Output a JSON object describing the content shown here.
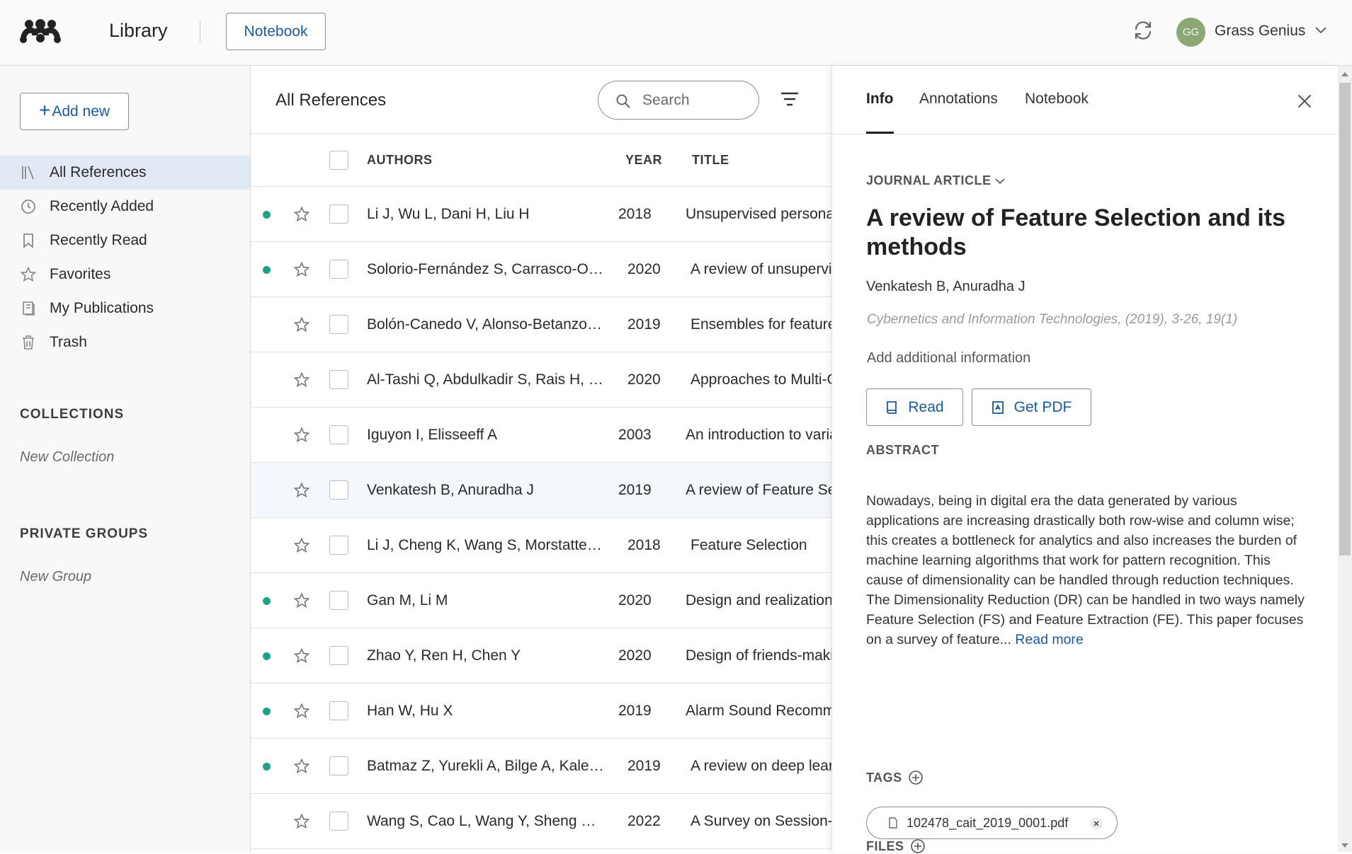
{
  "app": {
    "title": "Library",
    "notebook_button": "Notebook",
    "user_initials": "GG",
    "user_name": "Grass Genius",
    "accent": "#1a5a9e",
    "unread_dot_color": "#1ea084"
  },
  "sidebar": {
    "add_new": "Add new",
    "items": [
      {
        "label": "All References",
        "icon": "library-icon",
        "active": true
      },
      {
        "label": "Recently Added",
        "icon": "clock-icon"
      },
      {
        "label": "Recently Read",
        "icon": "bookmark-icon"
      },
      {
        "label": "Favorites",
        "icon": "star-icon"
      },
      {
        "label": "My Publications",
        "icon": "publications-icon"
      },
      {
        "label": "Trash",
        "icon": "trash-icon"
      }
    ],
    "collections_heading": "COLLECTIONS",
    "new_collection": "New Collection",
    "groups_heading": "PRIVATE GROUPS",
    "new_group": "New Group"
  },
  "list": {
    "title": "All References",
    "search_placeholder": "Search",
    "columns": {
      "authors": "AUTHORS",
      "year": "YEAR",
      "title": "TITLE"
    },
    "rows": [
      {
        "unread": true,
        "authors": "Li J, Wu L, Dani H, Liu H",
        "year": "2018",
        "title": "Unsupervised personalized"
      },
      {
        "unread": true,
        "authors": "Solorio-Fernández S, Carrasco-O…",
        "year": "2020",
        "title": "A review of unsupervised"
      },
      {
        "unread": false,
        "authors": "Bolón-Canedo V, Alonso-Betanzo…",
        "year": "2019",
        "title": "Ensembles for feature"
      },
      {
        "unread": false,
        "authors": "Al-Tashi Q, Abdulkadir S, Rais H, …",
        "year": "2020",
        "title": "Approaches to Multi-Objective"
      },
      {
        "unread": false,
        "authors": "Iguyon I, Elisseeff A",
        "year": "2003",
        "title": "An introduction to variable"
      },
      {
        "unread": false,
        "authors": "Venkatesh B, Anuradha J",
        "year": "2019",
        "title": "A review of Feature Selection",
        "selected": true
      },
      {
        "unread": false,
        "authors": "Li J, Cheng K, Wang S, Morstatte…",
        "year": "2018",
        "title": "Feature Selection"
      },
      {
        "unread": true,
        "authors": "Gan M, Li M",
        "year": "2020",
        "title": "Design and realization"
      },
      {
        "unread": true,
        "authors": "Zhao Y, Ren H, Chen Y",
        "year": "2020",
        "title": "Design of friends-making"
      },
      {
        "unread": true,
        "authors": "Han W, Hu X",
        "year": "2019",
        "title": "Alarm Sound Recommendation"
      },
      {
        "unread": true,
        "authors": "Batmaz Z, Yurekli A, Bilge A, Kale…",
        "year": "2019",
        "title": "A review on deep learning"
      },
      {
        "unread": false,
        "authors": "Wang S, Cao L, Wang Y, Sheng …",
        "year": "2022",
        "title": "A Survey on Session-based"
      }
    ]
  },
  "detail": {
    "tabs": [
      "Info",
      "Annotations",
      "Notebook"
    ],
    "type": "JOURNAL ARTICLE",
    "title": "A review of Feature Selection and its methods",
    "authors": "Venkatesh B, Anuradha J",
    "source": "Cybernetics and Information Technologies, (2019), 3-26, 19(1)",
    "add_info": "Add additional information",
    "read_button": "Read",
    "pdf_button": "Get PDF",
    "abstract_heading": "ABSTRACT",
    "abstract": "Nowadays, being in digital era the data generated by various applications are increasing drastically both row-wise and column wise; this creates a bottleneck for analytics and also increases the burden of machine learning algorithms that work for pattern recognition. This cause of dimensionality can be handled through reduction techniques. The Dimensionality Reduction (DR) can be handled in two ways namely Feature Selection (FS) and Feature Extraction (FE). This paper focuses on a survey of feature...",
    "read_more": "Read more",
    "tags_heading": "TAGS",
    "files_heading": "FILES",
    "file_name": "102478_cait_2019_0001.pdf"
  }
}
